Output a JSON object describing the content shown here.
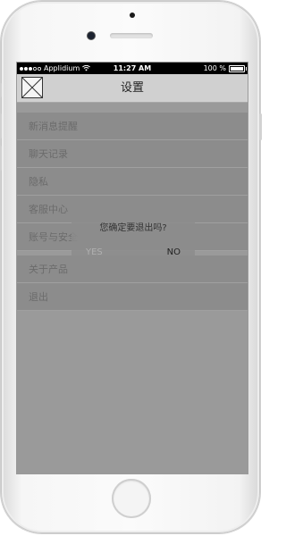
{
  "statusbar": {
    "carrier": "Applidium",
    "time": "11:27 AM",
    "battery_label": "100 %",
    "battery_level": 1.0,
    "signal_bars_filled": 3,
    "signal_bars_total": 5
  },
  "navbar": {
    "title": "设置",
    "left_image": "placeholder-image-icon"
  },
  "menu": {
    "items": [
      {
        "label": "新消息提醒"
      },
      {
        "label": "聊天记录"
      },
      {
        "label": "隐私"
      },
      {
        "label": "客服中心"
      },
      {
        "label": "账号与安全"
      },
      {
        "label": "关于产品"
      },
      {
        "label": "退出"
      }
    ]
  },
  "dialog": {
    "message": "您确定要退出吗?",
    "yes_label": "YES",
    "no_label": "NO"
  },
  "colors": {
    "screen_bg": "#9a9a9a",
    "navbar_bg": "#d0d0d0",
    "menu_item_bg": "#8c8c8c"
  }
}
